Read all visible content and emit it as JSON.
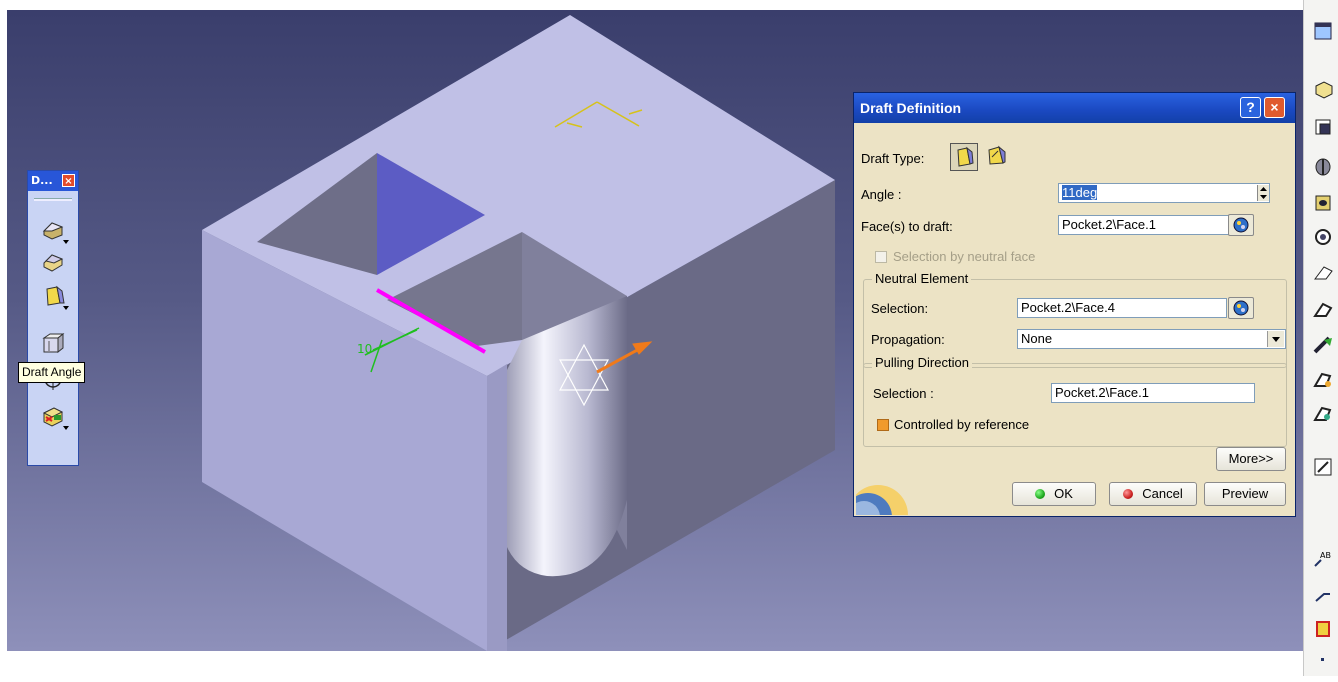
{
  "toolbar": {
    "title": "D...",
    "close": "×",
    "buttons": [
      {
        "icon": "edge-fillet-icon"
      },
      {
        "icon": "chamfer-icon"
      },
      {
        "icon": "draft-angle-icon"
      },
      {
        "icon": "shell-icon"
      },
      {
        "icon": "thread-icon"
      },
      {
        "icon": "remove-face-icon"
      },
      {
        "icon": "replace-face-icon"
      }
    ]
  },
  "tooltip": "Draft Angle",
  "viewport": {
    "angle_annotation": "10"
  },
  "dialog": {
    "title": "Draft Definition",
    "help": "?",
    "close": "×",
    "draft_type_label": "Draft Type:",
    "angle_label": "Angle :",
    "angle_value": "11deg",
    "faces_label": "Face(s) to draft:",
    "faces_value": "Pocket.2\\Face.1",
    "neutral_face_label": "Selection by neutral face",
    "neutral_group": "Neutral Element",
    "neutral_selection_label": "Selection:",
    "neutral_selection_value": "Pocket.2\\Face.4",
    "propagation_label": "Propagation:",
    "propagation_value": "None",
    "pulling_group": "Pulling Direction",
    "pulling_selection_label": "Selection :",
    "pulling_selection_value": "Pocket.2\\Face.1",
    "controlled_label": "Controlled by reference",
    "more_button": "More>>",
    "ok_button": "OK",
    "cancel_button": "Cancel",
    "preview_button": "Preview"
  },
  "colors": {
    "viewport_top": "#3a3e6c",
    "viewport_bottom": "#8e90ba",
    "part_top": "#c0c0e6",
    "neutral_edge": "#ff00ff",
    "draft_face": "#5a5ac8",
    "ok_green": "#22aa22",
    "cancel_red": "#cc2222"
  }
}
